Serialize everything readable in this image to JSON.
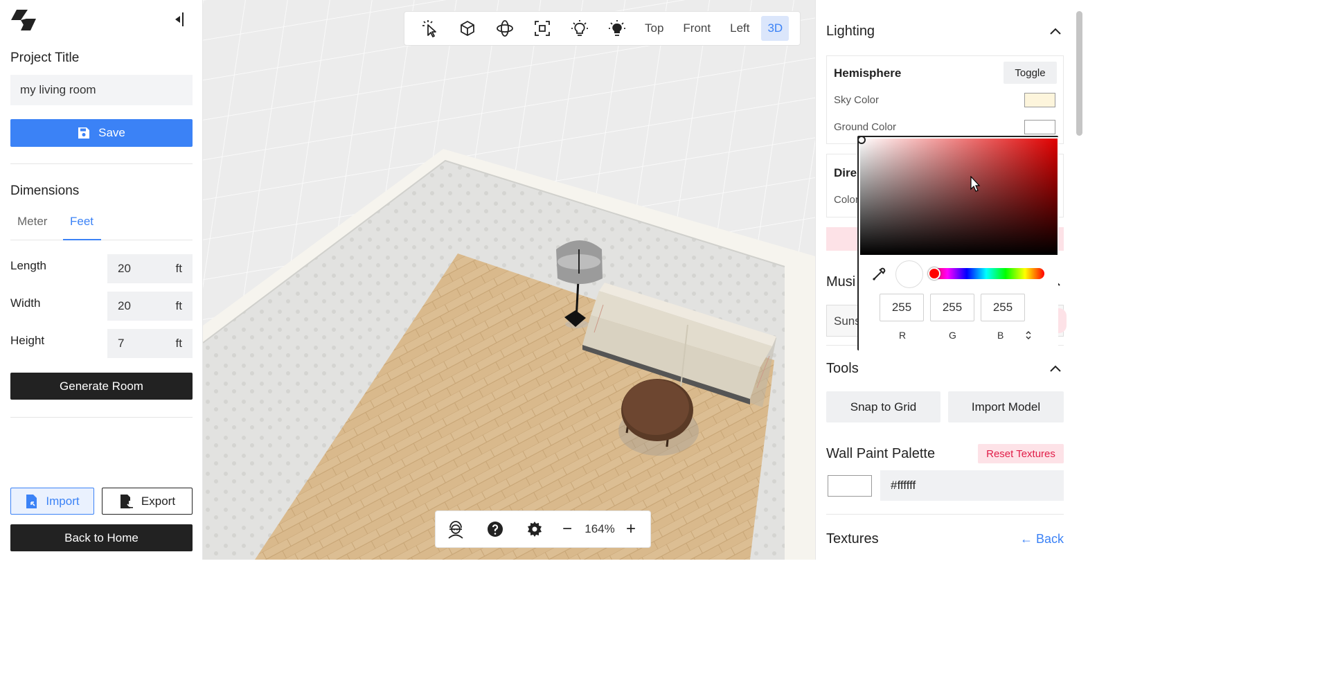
{
  "left": {
    "project_title_label": "Project Title",
    "project_title_value": "my living room",
    "save_label": "Save",
    "dimensions_label": "Dimensions",
    "tabs": [
      {
        "label": "Meter",
        "active": false
      },
      {
        "label": "Feet",
        "active": true
      }
    ],
    "fields": [
      {
        "label": "Length",
        "value": "20",
        "unit": "ft"
      },
      {
        "label": "Width",
        "value": "20",
        "unit": "ft"
      },
      {
        "label": "Height",
        "value": "7",
        "unit": "ft"
      }
    ],
    "generate_label": "Generate Room",
    "import_label": "Import",
    "export_label": "Export",
    "back_label": "Back to Home"
  },
  "toolbar": {
    "icons": [
      "select-cursor-icon",
      "box-icon",
      "orbit-icon",
      "focus-frame-icon",
      "bulb-outline-icon",
      "bulb-filled-icon"
    ],
    "views": [
      {
        "label": "Top",
        "active": false
      },
      {
        "label": "Front",
        "active": false
      },
      {
        "label": "Left",
        "active": false
      },
      {
        "label": "3D",
        "active": true
      }
    ]
  },
  "bottom": {
    "zoom": "164%",
    "icons": [
      "avatar-icon",
      "help-icon",
      "settings-icon"
    ],
    "zoom_out": "−",
    "zoom_in": "+"
  },
  "right": {
    "lighting_label": "Lighting",
    "hemisphere_label": "Hemisphere",
    "toggle_label": "Toggle",
    "sky_color_label": "Sky Color",
    "sky_color": "#fdf5dc",
    "ground_color_label": "Ground Color",
    "ground_color": "#ffffff",
    "directional_label": "Dire",
    "color_label": "Color",
    "music_label": "Musi",
    "music_value": "Suns",
    "tools_label": "Tools",
    "snap_label": "Snap to Grid",
    "import_model_label": "Import Model",
    "wall_paint_label": "Wall Paint Palette",
    "reset_textures_label": "Reset Textures",
    "wall_color": "#ffffff",
    "wall_hex": "#ffffff",
    "textures_label": "Textures",
    "back_label": "← Back"
  },
  "picker": {
    "r": "255",
    "g": "255",
    "b": "255",
    "r_label": "R",
    "g_label": "G",
    "b_label": "B",
    "hue_color": "#ff0000"
  },
  "colors": {
    "accent": "#3b82f6",
    "dark": "#222222",
    "danger": "#e11d48",
    "danger_bg": "#fde2e7"
  }
}
